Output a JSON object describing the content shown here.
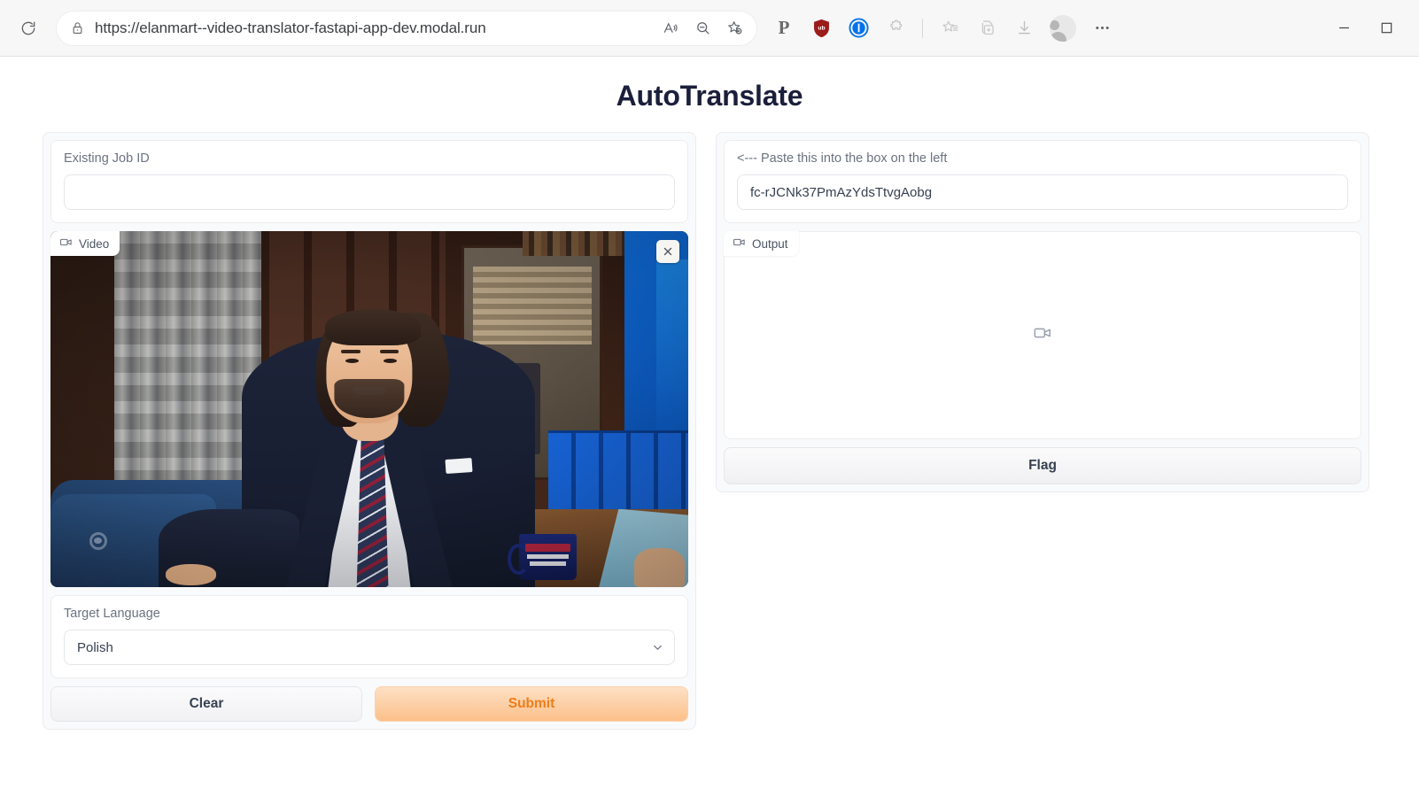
{
  "browser": {
    "url": "https://elanmart--video-translator-fastapi-app-dev.modal.run",
    "reload_label": "reload-icon",
    "lock_label": "lock-icon",
    "read_aloud_label": "read-aloud-icon",
    "zoom_out_label": "zoom-out-icon",
    "add_favorite_label": "add-favorite-icon",
    "extensions": [
      {
        "name": "paypal-extension-icon",
        "glyph": "P",
        "color": "#6b6b6b"
      },
      {
        "name": "ublock-origin-extension-icon",
        "glyph": "ub",
        "color": "#9c1b1b"
      },
      {
        "name": "onepassword-extension-icon",
        "glyph": "1",
        "color": "#0572ec"
      },
      {
        "name": "extensions-puzzle-icon",
        "glyph": "",
        "color": "#c7c7c7"
      }
    ],
    "favorites_label": "favorites-icon",
    "collections_label": "collections-icon",
    "downloads_label": "downloads-icon",
    "profile_label": "profile-avatar",
    "settings_label": "settings-ellipsis-icon",
    "minimize_label": "minimize-button",
    "maximize_label": "maximize-button"
  },
  "app": {
    "title": "AutoTranslate"
  },
  "left": {
    "job_id": {
      "label": "Existing Job ID",
      "value": "",
      "placeholder": ""
    },
    "video": {
      "chip_label": "Video",
      "chip_icon": "video-camera-icon",
      "close_icon": "close-icon",
      "scene": {
        "watermark": "CBS",
        "mug_text_line1": "LATE",
        "mug_text_line2": "SHOW",
        "mug_text_line3": "stephen",
        "mug_text_line4": "colbert."
      }
    },
    "target_language": {
      "label": "Target Language",
      "selected": "Polish",
      "options": [
        "Polish"
      ]
    },
    "buttons": {
      "clear": "Clear",
      "submit": "Submit"
    }
  },
  "right": {
    "paste_hint": {
      "label": "<--- Paste this into the box on the left",
      "value": "fc-rJCNk37PmAzYdsTtvgAobg"
    },
    "output": {
      "chip_label": "Output",
      "chip_icon": "video-camera-icon",
      "placeholder_icon": "video-camera-icon"
    },
    "flag_button": "Flag"
  },
  "colors": {
    "title": "#1b1f3b",
    "submit_bg": "#fcc08a",
    "submit_text": "#ef7d1a",
    "panel_bg": "#f9fafb",
    "border": "#ededf0"
  }
}
